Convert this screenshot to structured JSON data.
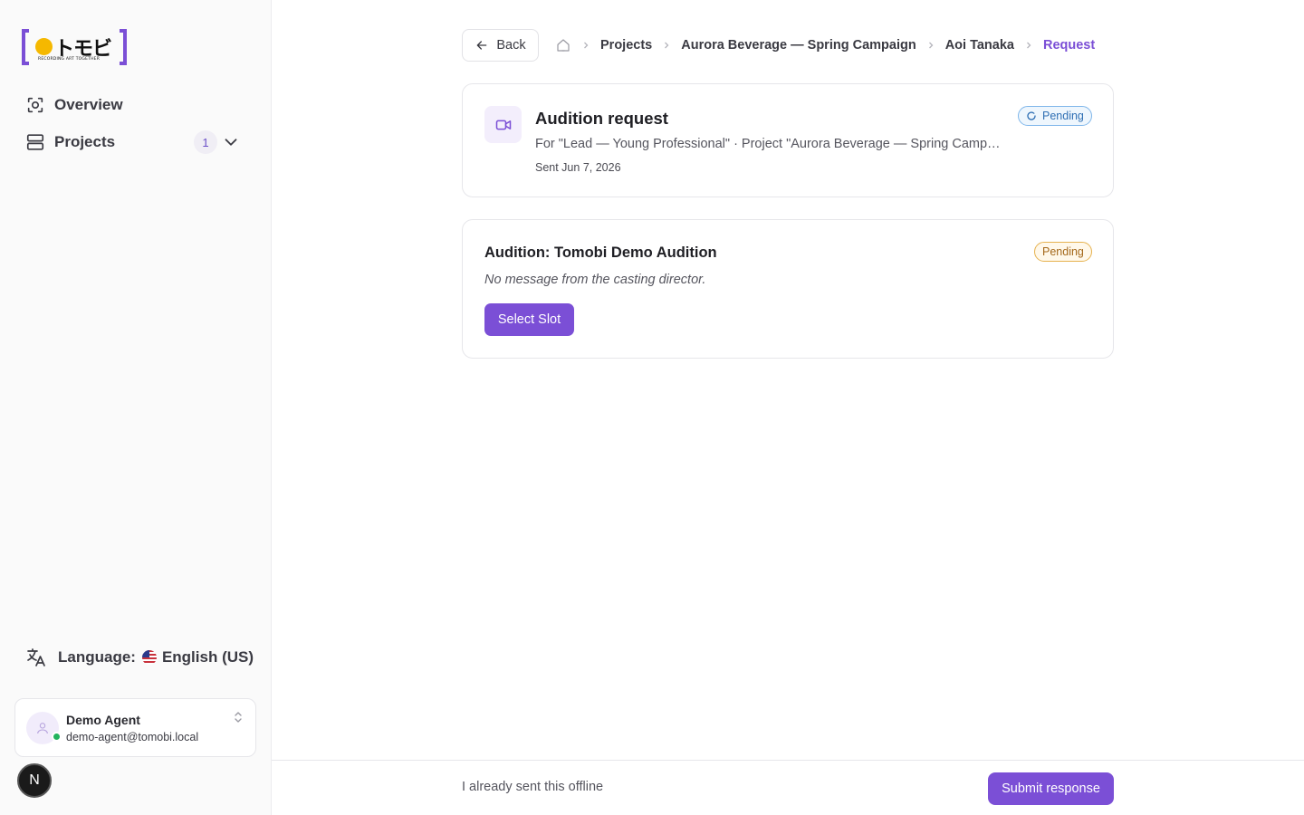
{
  "brand": {
    "logo_text": "トモビ",
    "tagline": "RECORDING ART TOGETHER",
    "accent": "#7b4fd6",
    "logo_dot": "#f5b800"
  },
  "sidebar": {
    "items": [
      {
        "label": "Overview",
        "icon": "scan-icon"
      },
      {
        "label": "Projects",
        "icon": "projects-icon",
        "badge": "1"
      }
    ],
    "language": {
      "label": "Language:",
      "value": "English (US)",
      "flag": "us-flag"
    },
    "user": {
      "name": "Demo Agent",
      "email": "demo-agent@tomobi.local",
      "status_color": "#22b35e"
    },
    "dev_badge": "N"
  },
  "topbar": {
    "back_label": "Back",
    "breadcrumbs": [
      "Projects",
      "Aurora Beverage — Spring Campaign",
      "Aoi Tanaka",
      "Request"
    ]
  },
  "request": {
    "title": "Audition request",
    "subtitle": "For \"Lead — Young Professional\" · Project \"Aurora Beverage — Spring Campaign\"",
    "sent": "Sent Jun 7, 2026",
    "status": "Pending",
    "status_color": "#2f6fb4"
  },
  "audition": {
    "title": "Audition: Tomobi Demo Audition",
    "message": "No message from the casting director.",
    "status": "Pending",
    "status_color": "#a4681a",
    "button_label": "Select Slot"
  },
  "footer": {
    "offline_label": "I already sent this offline",
    "submit_label": "Submit response"
  }
}
